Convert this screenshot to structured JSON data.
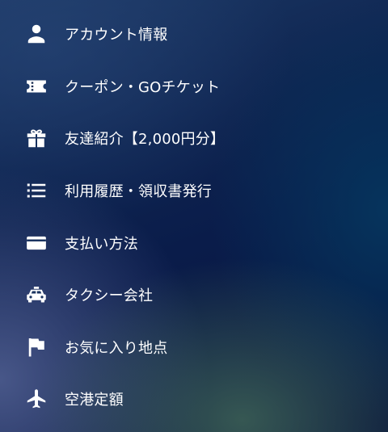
{
  "menu": {
    "items": [
      {
        "icon": "person-icon",
        "label": "アカウント情報"
      },
      {
        "icon": "ticket-icon",
        "label": "クーポン・GOチケット"
      },
      {
        "icon": "gift-icon",
        "label": "友達紹介【2,000円分】"
      },
      {
        "icon": "list-icon",
        "label": "利用履歴・領収書発行"
      },
      {
        "icon": "credit-card-icon",
        "label": "支払い方法"
      },
      {
        "icon": "taxi-icon",
        "label": "タクシー会社"
      },
      {
        "icon": "flag-icon",
        "label": "お気に入り地点"
      },
      {
        "icon": "airplane-icon",
        "label": "空港定額"
      }
    ]
  },
  "colors": {
    "text": "#ffffff",
    "icon": "#ffffff"
  }
}
